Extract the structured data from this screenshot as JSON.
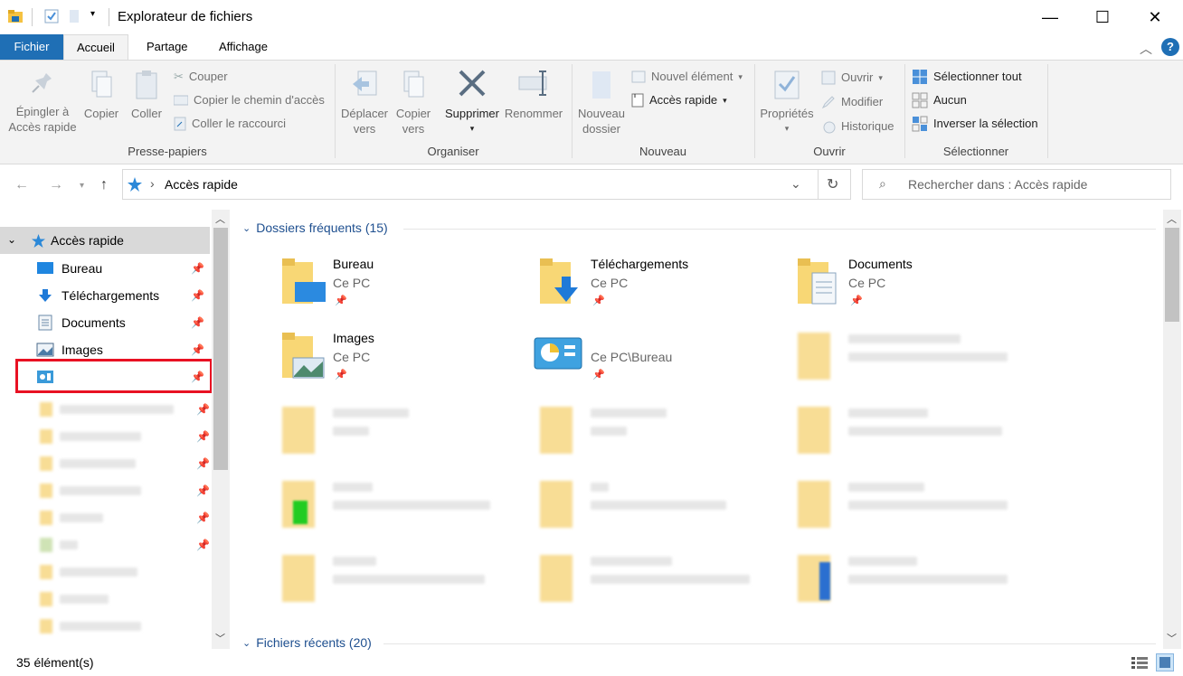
{
  "window": {
    "title": "Explorateur de fichiers",
    "controls": {
      "minimize": "—",
      "maximize": "☐",
      "close": "✕"
    }
  },
  "ribbon_tabs": [
    "Fichier",
    "Accueil",
    "Partage",
    "Affichage"
  ],
  "ribbon": {
    "presse_papiers": {
      "label": "Presse-papiers",
      "pin": "Épingler à\nAccès rapide",
      "copy": "Copier",
      "paste": "Coller",
      "cut": "Couper",
      "copy_path": "Copier le chemin d'accès",
      "paste_shortcut": "Coller le raccourci"
    },
    "organiser": {
      "label": "Organiser",
      "move_to": "Déplacer\nvers",
      "copy_to": "Copier\nvers",
      "delete": "Supprimer",
      "rename": "Renommer"
    },
    "nouveau": {
      "label": "Nouveau",
      "new_folder": "Nouveau\ndossier",
      "new_item": "Nouvel élément",
      "easy_access": "Accès rapide"
    },
    "ouvrir": {
      "label": "Ouvrir",
      "properties": "Propriétés",
      "open": "Ouvrir",
      "edit": "Modifier",
      "history": "Historique"
    },
    "selectionner": {
      "label": "Sélectionner",
      "select_all": "Sélectionner tout",
      "select_none": "Aucun",
      "invert": "Inverser la sélection"
    }
  },
  "address": {
    "path": "Accès rapide",
    "search_placeholder": "Rechercher dans : Accès rapide"
  },
  "nav": {
    "root": "Accès rapide",
    "items": [
      {
        "label": "Bureau",
        "icon": "desktop-icon"
      },
      {
        "label": "Téléchargements",
        "icon": "downloads-icon"
      },
      {
        "label": "Documents",
        "icon": "documents-icon"
      },
      {
        "label": "Images",
        "icon": "pictures-icon"
      },
      {
        "label": "",
        "icon": "control-panel-icon",
        "highlighted": true
      }
    ]
  },
  "content": {
    "frequent_header": "Dossiers fréquents (15)",
    "recent_header": "Fichiers récents (20)",
    "tiles": [
      {
        "name": "Bureau",
        "sub": "Ce PC"
      },
      {
        "name": "Téléchargements",
        "sub": "Ce PC"
      },
      {
        "name": "Documents",
        "sub": "Ce PC"
      },
      {
        "name": "Images",
        "sub": "Ce PC"
      },
      {
        "name": "",
        "sub": "Ce PC\\Bureau"
      }
    ]
  },
  "status": {
    "count": "35 élément(s)"
  },
  "colors": {
    "accent": "#1f6fb5",
    "folder": "#f8d775",
    "highlight_box": "#e81123",
    "link": "#1e4f8f"
  }
}
